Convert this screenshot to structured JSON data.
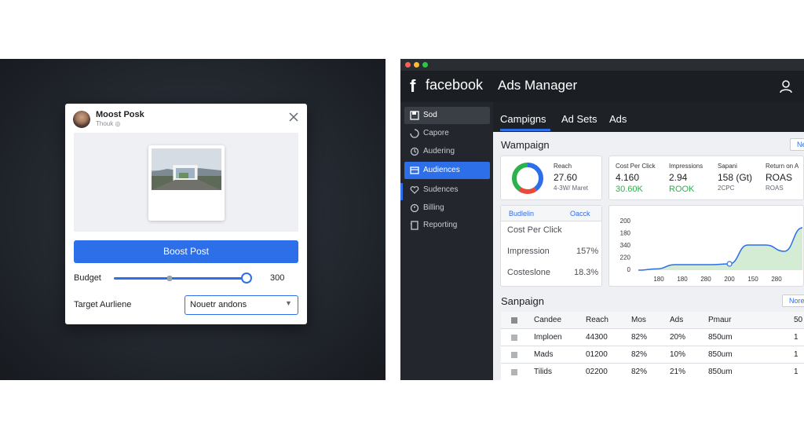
{
  "boost_dialog": {
    "title": "Moost Posk",
    "subtitle": "Thouk ◎",
    "close_icon": "close-icon",
    "boost_button": "Boost Post",
    "budget_label": "Budget",
    "budget_slider_fraction": 1.0,
    "budget_value": "300",
    "target_label": "Target Aurliene",
    "target_value": "Nouetr andons"
  },
  "ads_manager": {
    "brand_f": "f",
    "brand_word": "facebook",
    "app_title": "Ads Manager",
    "sidebar": [
      {
        "label": "Sod",
        "icon": "save-icon",
        "state": "top"
      },
      {
        "label": "Capore",
        "icon": "circle-icon",
        "state": ""
      },
      {
        "label": "Audering",
        "icon": "refresh-icon",
        "state": ""
      },
      {
        "label": "Audiences",
        "icon": "folder-icon",
        "state": "active"
      },
      {
        "label": "Sudences",
        "icon": "heart-icon",
        "state": ""
      },
      {
        "label": "Billing",
        "icon": "billing-icon",
        "state": ""
      },
      {
        "label": "Reporting",
        "icon": "reporting-icon",
        "state": ""
      }
    ],
    "tabs": [
      "Campigns",
      "Ad Sets",
      "Ads"
    ],
    "wampaign": {
      "title": "Wampaign",
      "ne_button": "Ne",
      "reach": {
        "label": "Reach",
        "value": "27.60",
        "sub": "4-3W/ Maret"
      },
      "metrics": [
        {
          "label": "Cost Per Click",
          "value": "4.160",
          "green": "30.60K"
        },
        {
          "label": "Impressions",
          "value": "2.94",
          "green": "ROOK"
        },
        {
          "label": "Sapani",
          "value": "158 (Gt)",
          "small": "2CPC"
        },
        {
          "label": "Return on A",
          "value": "ROAS",
          "small": "ROAS"
        }
      ],
      "donut": {
        "segments": [
          {
            "color": "#2d6fe8",
            "fraction": 0.4
          },
          {
            "color": "#e9483b",
            "fraction": 0.2
          },
          {
            "color": "#2bb24c",
            "fraction": 0.4
          }
        ]
      }
    },
    "budget_card": {
      "header_left": "Budlelin",
      "header_right": "Oacck",
      "rows": [
        {
          "label": "Cost Per Click",
          "value": ""
        },
        {
          "label": "Impression",
          "value": "157%"
        },
        {
          "label": "Costeslone",
          "value": "18.3%"
        }
      ]
    },
    "chart_data": {
      "type": "area",
      "x_tick_labels": [
        "180",
        "180",
        "280",
        "200",
        "150",
        "280"
      ],
      "y_tick_labels": [
        "200",
        "180",
        "340",
        "220",
        "0"
      ],
      "y_values": [
        0,
        8,
        35,
        35,
        35,
        40,
        160,
        160,
        120,
        270
      ],
      "ylim": [
        0,
        340
      ]
    },
    "sanpaign": {
      "title": "Sanpaign",
      "ne_button": "Nore",
      "columns": [
        "Candee",
        "Reach",
        "Mos",
        "Ads",
        "Pmaur",
        "50"
      ],
      "rows": [
        [
          "Imploen",
          "44300",
          "82%",
          "20%",
          "850um",
          "1"
        ],
        [
          "Mads",
          "01200",
          "82%",
          "10%",
          "850um",
          "1"
        ],
        [
          "Tilids",
          "02200",
          "82%",
          "21%",
          "850um",
          "1"
        ]
      ]
    },
    "colors": {
      "accent": "#2d6fe8",
      "green": "#2bb24c",
      "red": "#e9483b"
    }
  }
}
